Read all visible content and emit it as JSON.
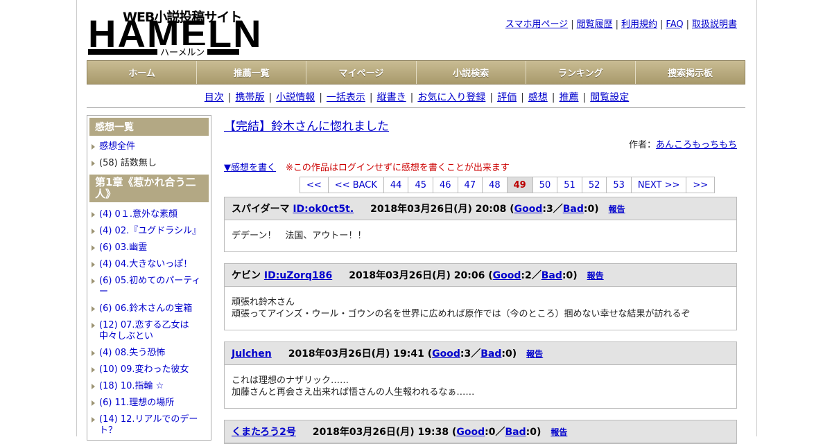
{
  "logo": {
    "tagline": "WEB小説投稿サイト",
    "main": "HAMELN",
    "sub": "ハーメルン"
  },
  "top_links": [
    "スマホ用ページ",
    "閲覧履歴",
    "利用規約",
    "FAQ",
    "取扱説明書"
  ],
  "nav": [
    "ホーム",
    "推薦一覧",
    "マイページ",
    "小説検索",
    "ランキング",
    "捜索掲示板"
  ],
  "sub_links": [
    "目次",
    "携帯版",
    "小説情報",
    "一括表示",
    "縦書き",
    "お気に入り登録",
    "評価",
    "感想",
    "推薦",
    "閲覧設定"
  ],
  "sidebar": {
    "header": "感想一覧",
    "top_items": [
      "感想全件",
      "(58) 話数無し"
    ],
    "chapter": "第1章《惹かれ合う二人》",
    "items": [
      "(4) 0１.意外な素顔",
      "(4) 02.『ユグドラシル』",
      "(6) 03.幽霊",
      "(4) 04.大きないっぽ！",
      "(6) 05.初めてのパーティー",
      "(6) 06.鈴木さんの宝箱",
      "(12) 07.恋する乙女は中々しぶとい",
      "(4) 08.失う恐怖",
      "(10) 09.変わった彼女",
      "(18) 10.指輪 ☆",
      "(6) 11.理想の場所",
      "(14) 12.リアルでのデート？"
    ]
  },
  "main": {
    "title": "【完結】鈴木さんに惚れました",
    "author_label": "作者：",
    "author": "あんころもっちもち",
    "write_link": "▼感想を書く",
    "write_note": "※この作品はログインせずに感想を書くことが出来ます",
    "pager": [
      "<<",
      "<< BACK",
      "44",
      "45",
      "46",
      "47",
      "48",
      "49",
      "50",
      "51",
      "52",
      "53",
      "NEXT >>",
      ">>"
    ],
    "current_page": "49"
  },
  "reviews": [
    {
      "name": "スパイダーマ",
      "id": "ID:ok0ct5t.",
      "date": "2018年03月26日(月) 20:08",
      "good": "3",
      "bad": "0",
      "report": "報告",
      "lines": [
        "デデーン！　法国、アウトー！！"
      ]
    },
    {
      "name": "ケビン",
      "id": "ID:uZorq186",
      "date": "2018年03月26日(月) 20:06",
      "good": "2",
      "bad": "0",
      "report": "報告",
      "lines": [
        "頑張れ鈴木さん",
        "頑張ってアインズ・ウール・ゴウンの名を世界に広めれば原作では（今のところ）掴めない幸せな結果が訪れるぞ"
      ]
    },
    {
      "name": "Julchen",
      "id": "",
      "date": "2018年03月26日(月) 19:41",
      "good": "3",
      "bad": "0",
      "report": "報告",
      "lines": [
        "これは理想のナザリック……",
        "加藤さんと再会さえ出来れば悟さんの人生報われるなぁ……"
      ]
    },
    {
      "name": "くまたろう2号",
      "id": "",
      "date": "2018年03月26日(月) 19:38",
      "good": "0",
      "bad": "0",
      "report": "報告",
      "lines": []
    }
  ],
  "labels": {
    "good": "Good",
    "bad": "Bad",
    "sep": "／"
  }
}
